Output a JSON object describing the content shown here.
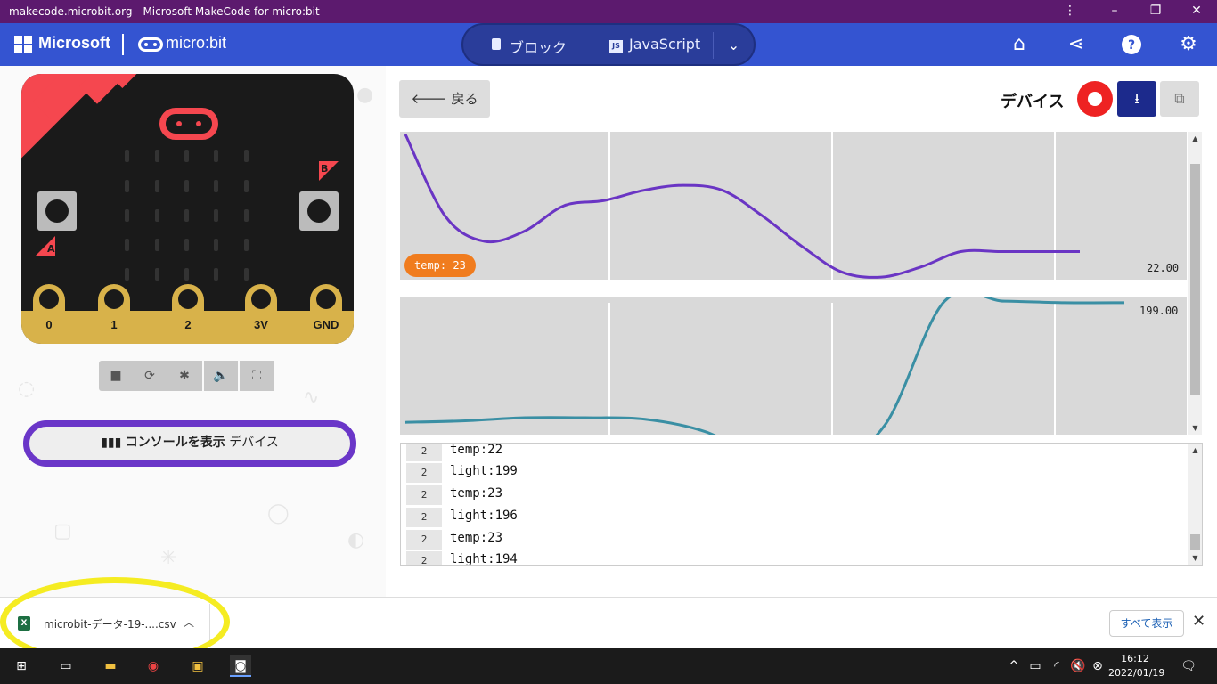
{
  "browser": {
    "title": "makecode.microbit.org - Microsoft MakeCode for micro:bit"
  },
  "header": {
    "brand": "Microsoft",
    "product": "micro:bit",
    "tabs": [
      {
        "label": "ブロック",
        "icon": "puzzle-piece-icon"
      },
      {
        "label": "JavaScript",
        "icon": "js-icon"
      }
    ],
    "icons": [
      "home-icon",
      "share-icon",
      "help-icon",
      "settings-icon"
    ]
  },
  "simulator": {
    "pins": [
      "0",
      "1",
      "2",
      "3V",
      "GND"
    ],
    "button_a": "A",
    "button_b": "B",
    "controls": [
      "stop-icon",
      "restart-icon",
      "debug-icon",
      "mute-icon",
      "fullscreen-icon"
    ]
  },
  "console_toggle": {
    "label": "コンソールを表示",
    "target": "デバイス"
  },
  "serial": {
    "back_label": "戻る",
    "title": "デバイス",
    "colors": {
      "temp": "#6a35c4",
      "light": "#3a8fa4",
      "record": "#e22222",
      "download": "#1c2a8c"
    }
  },
  "chart_data": [
    {
      "type": "line",
      "series": [
        {
          "name": "temp",
          "values": [
            24.8,
            23.2,
            22.7,
            22.9,
            23.4,
            23.5,
            23.7,
            23.8,
            23.7,
            23.2,
            22.6,
            22.1,
            22.0,
            22.2,
            22.5,
            22.5,
            22.5,
            22.5
          ]
        }
      ],
      "latest_label": "temp: 23",
      "value_label": "22.00"
    },
    {
      "type": "line",
      "series": [
        {
          "name": "light",
          "values": [
            120,
            121,
            123,
            123,
            122,
            114,
            96,
            92,
            118,
            199,
            199,
            198,
            198
          ]
        }
      ],
      "value_label": "199.00"
    }
  ],
  "console_lines": [
    {
      "count": "2",
      "text": "temp:22"
    },
    {
      "count": "2",
      "text": "light:199"
    },
    {
      "count": "2",
      "text": "temp:23"
    },
    {
      "count": "2",
      "text": "light:196"
    },
    {
      "count": "2",
      "text": "temp:23"
    },
    {
      "count": "2",
      "text": "light:194"
    }
  ],
  "downloads": {
    "file": "microbit-データ-19-....csv",
    "show_all": "すべて表示"
  },
  "taskbar": {
    "time": "16:12",
    "date": "2022/01/19"
  }
}
